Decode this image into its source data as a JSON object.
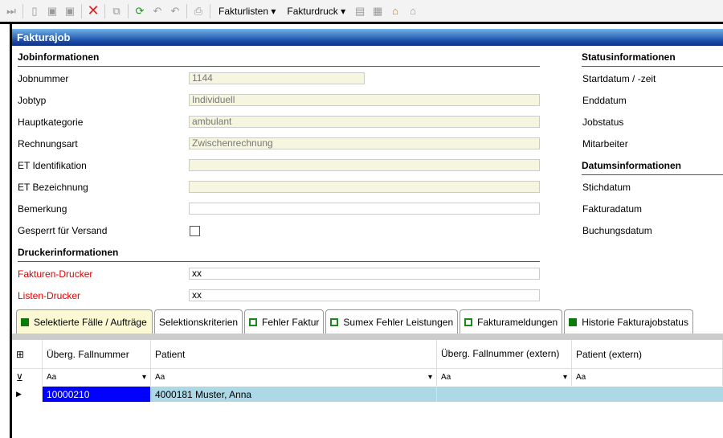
{
  "toolbar": {
    "menu1": "Fakturlisten",
    "menu2": "Fakturdruck"
  },
  "window": {
    "title": "Fakturajob"
  },
  "job": {
    "section": "Jobinformationen",
    "fields": [
      {
        "label": "Jobnummer",
        "value": "1144"
      },
      {
        "label": "Jobtyp",
        "value": "Individuell"
      },
      {
        "label": "Hauptkategorie",
        "value": "ambulant"
      },
      {
        "label": "Rechnungsart",
        "value": "Zwischenrechnung"
      },
      {
        "label": "ET Identifikation",
        "value": ""
      },
      {
        "label": "ET Bezeichnung",
        "value": ""
      },
      {
        "label": "Bemerkung",
        "value": ""
      }
    ],
    "locked_label": "Gesperrt für Versand"
  },
  "printer": {
    "section": "Druckerinformationen",
    "invoice_label": "Fakturen-Drucker",
    "invoice_value": "xx",
    "list_label": "Listen-Drucker",
    "list_value": "xx"
  },
  "status": {
    "section": "Statusinformationen",
    "items": [
      "Startdatum / -zeit",
      "Enddatum",
      "Jobstatus",
      "Mitarbeiter"
    ],
    "date_section": "Datumsinformationen",
    "date_items": [
      "Stichdatum",
      "Fakturadatum",
      "Buchungsdatum"
    ]
  },
  "tabs": [
    "Selektierte Fälle / Aufträge",
    "Selektionskriterien",
    "Fehler Faktur",
    "Sumex Fehler Leistungen",
    "Fakturameldungen",
    "Historie Fakturajobstatus"
  ],
  "grid": {
    "columns": [
      "Überg. Fallnummer",
      "Patient",
      "Überg. Fallnummer (extern)",
      "Patient (extern)"
    ],
    "filter": "Aa",
    "rows": [
      {
        "fallnummer": "10000210",
        "patient": "4000181 Muster, Anna"
      }
    ]
  }
}
